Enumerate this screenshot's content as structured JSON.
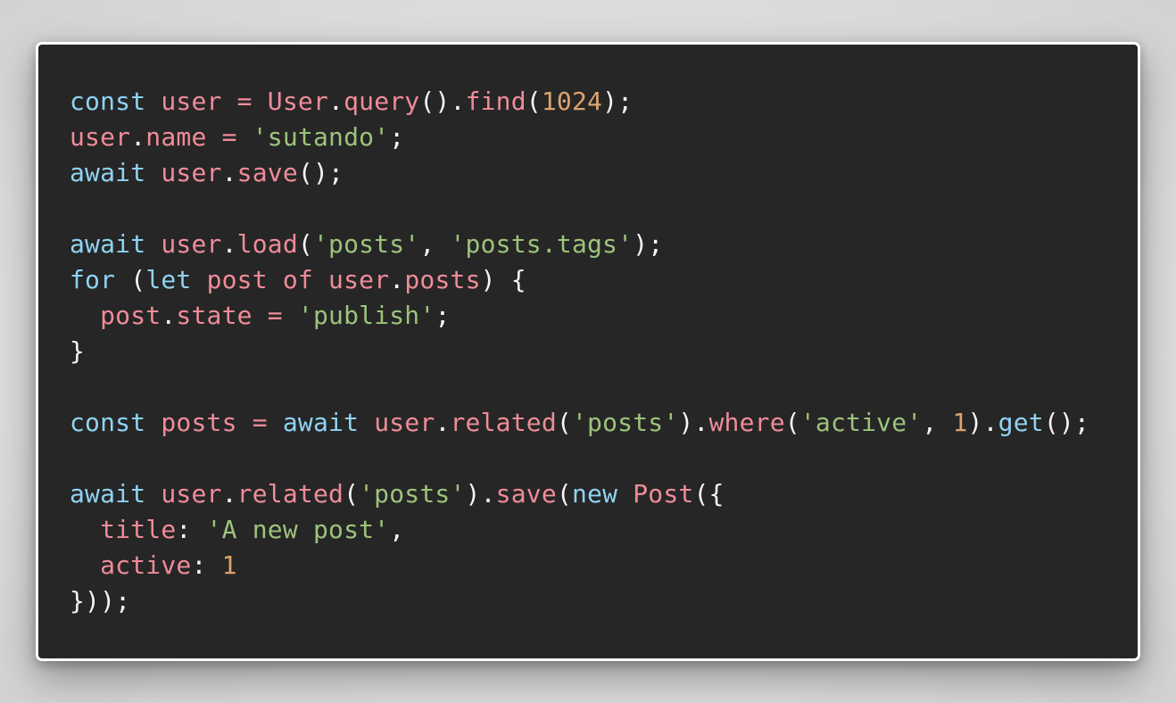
{
  "colors": {
    "background": "#262626",
    "keyword": "#8fd3f2",
    "identifier": "#ef8c98",
    "string": "#9cc37c",
    "number": "#dca36d",
    "punctuation": "#f5f5f5"
  },
  "code": {
    "lines": [
      [
        [
          "kw",
          "const"
        ],
        [
          "pun",
          " "
        ],
        [
          "id",
          "user"
        ],
        [
          "pun",
          " "
        ],
        [
          "id",
          "="
        ],
        [
          "pun",
          " "
        ],
        [
          "id",
          "User"
        ],
        [
          "pun",
          "."
        ],
        [
          "fn",
          "query"
        ],
        [
          "pun",
          "()."
        ],
        [
          "fn",
          "find"
        ],
        [
          "pun",
          "("
        ],
        [
          "num",
          "1024"
        ],
        [
          "pun",
          ");"
        ]
      ],
      [
        [
          "id",
          "user"
        ],
        [
          "pun",
          "."
        ],
        [
          "id",
          "name"
        ],
        [
          "pun",
          " "
        ],
        [
          "id",
          "="
        ],
        [
          "pun",
          " "
        ],
        [
          "str",
          "'sutando'"
        ],
        [
          "pun",
          ";"
        ]
      ],
      [
        [
          "kw",
          "await"
        ],
        [
          "pun",
          " "
        ],
        [
          "id",
          "user"
        ],
        [
          "pun",
          "."
        ],
        [
          "fn",
          "save"
        ],
        [
          "pun",
          "();"
        ]
      ],
      [],
      [
        [
          "kw",
          "await"
        ],
        [
          "pun",
          " "
        ],
        [
          "id",
          "user"
        ],
        [
          "pun",
          "."
        ],
        [
          "fn",
          "load"
        ],
        [
          "pun",
          "("
        ],
        [
          "str",
          "'posts'"
        ],
        [
          "pun",
          ", "
        ],
        [
          "str",
          "'posts.tags'"
        ],
        [
          "pun",
          ");"
        ]
      ],
      [
        [
          "kw",
          "for"
        ],
        [
          "pun",
          " ("
        ],
        [
          "kw",
          "let"
        ],
        [
          "pun",
          " "
        ],
        [
          "id",
          "post"
        ],
        [
          "pun",
          " "
        ],
        [
          "id",
          "of"
        ],
        [
          "pun",
          " "
        ],
        [
          "id",
          "user"
        ],
        [
          "pun",
          "."
        ],
        [
          "id",
          "posts"
        ],
        [
          "pun",
          ") {"
        ]
      ],
      [
        [
          "pun",
          "  "
        ],
        [
          "id",
          "post"
        ],
        [
          "pun",
          "."
        ],
        [
          "id",
          "state"
        ],
        [
          "pun",
          " "
        ],
        [
          "id",
          "="
        ],
        [
          "pun",
          " "
        ],
        [
          "str",
          "'publish'"
        ],
        [
          "pun",
          ";"
        ]
      ],
      [
        [
          "pun",
          "}"
        ]
      ],
      [],
      [
        [
          "kw",
          "const"
        ],
        [
          "pun",
          " "
        ],
        [
          "id",
          "posts"
        ],
        [
          "pun",
          " "
        ],
        [
          "id",
          "="
        ],
        [
          "pun",
          " "
        ],
        [
          "kw",
          "await"
        ],
        [
          "pun",
          " "
        ],
        [
          "id",
          "user"
        ],
        [
          "pun",
          "."
        ],
        [
          "fn",
          "related"
        ],
        [
          "pun",
          "("
        ],
        [
          "str",
          "'posts'"
        ],
        [
          "pun",
          ")."
        ],
        [
          "fn",
          "where"
        ],
        [
          "pun",
          "("
        ],
        [
          "str",
          "'active'"
        ],
        [
          "pun",
          ", "
        ],
        [
          "num",
          "1"
        ],
        [
          "pun",
          ")."
        ],
        [
          "kw",
          "get"
        ],
        [
          "pun",
          "();"
        ]
      ],
      [],
      [
        [
          "kw",
          "await"
        ],
        [
          "pun",
          " "
        ],
        [
          "id",
          "user"
        ],
        [
          "pun",
          "."
        ],
        [
          "fn",
          "related"
        ],
        [
          "pun",
          "("
        ],
        [
          "str",
          "'posts'"
        ],
        [
          "pun",
          ")."
        ],
        [
          "fn",
          "save"
        ],
        [
          "pun",
          "("
        ],
        [
          "kw",
          "new"
        ],
        [
          "pun",
          " "
        ],
        [
          "id",
          "Post"
        ],
        [
          "pun",
          "({"
        ]
      ],
      [
        [
          "pun",
          "  "
        ],
        [
          "id",
          "title"
        ],
        [
          "pun",
          ": "
        ],
        [
          "str",
          "'A new post'"
        ],
        [
          "pun",
          ","
        ]
      ],
      [
        [
          "pun",
          "  "
        ],
        [
          "id",
          "active"
        ],
        [
          "pun",
          ": "
        ],
        [
          "num",
          "1"
        ]
      ],
      [
        [
          "pun",
          "}));"
        ]
      ]
    ]
  }
}
